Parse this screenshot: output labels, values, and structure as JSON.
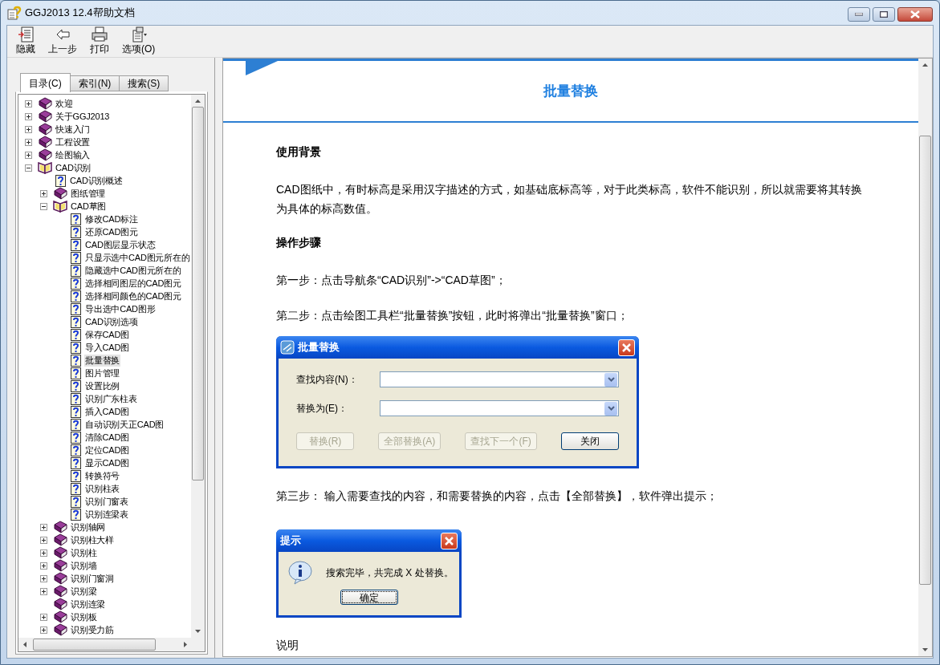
{
  "window": {
    "title": "GGJ2013 12.4帮助文档"
  },
  "toolbar": [
    {
      "label": "隐藏",
      "kind": "hide"
    },
    {
      "label": "上一步",
      "kind": "back"
    },
    {
      "label": "打印",
      "kind": "print"
    },
    {
      "label": "选项(O)",
      "kind": "options"
    }
  ],
  "tabs": [
    {
      "label": "目录(C)",
      "selected": true
    },
    {
      "label": "索引(N)",
      "selected": false
    },
    {
      "label": "搜索(S)",
      "selected": false
    }
  ],
  "tree": [
    {
      "label": "欢迎",
      "kind": "book",
      "expanded": false,
      "selected": false
    },
    {
      "label": "关于GGJ2013",
      "kind": "book",
      "expanded": false,
      "selected": false
    },
    {
      "label": "快速入门",
      "kind": "book",
      "expanded": false,
      "selected": false
    },
    {
      "label": "工程设置",
      "kind": "book",
      "expanded": false,
      "selected": false
    },
    {
      "label": "绘图输入",
      "kind": "book",
      "expanded": false,
      "selected": false
    },
    {
      "label": "CAD识别",
      "kind": "book",
      "expanded": true,
      "selected": false,
      "children": [
        {
          "label": "CAD识别概述",
          "kind": "page",
          "selected": false
        },
        {
          "label": "图纸管理",
          "kind": "book",
          "expanded": false,
          "selected": false
        },
        {
          "label": "CAD草图",
          "kind": "book",
          "expanded": true,
          "selected": false,
          "children": [
            {
              "label": "修改CAD标注",
              "kind": "page",
              "selected": false
            },
            {
              "label": "还原CAD图元",
              "kind": "page",
              "selected": false
            },
            {
              "label": "CAD图层显示状态",
              "kind": "page",
              "selected": false
            },
            {
              "label": "只显示选中CAD图元所在的",
              "kind": "page",
              "selected": false
            },
            {
              "label": "隐藏选中CAD图元所在的",
              "kind": "page",
              "selected": false
            },
            {
              "label": "选择相同图层的CAD图元",
              "kind": "page",
              "selected": false
            },
            {
              "label": "选择相同颜色的CAD图元",
              "kind": "page",
              "selected": false
            },
            {
              "label": "导出选中CAD图形",
              "kind": "page",
              "selected": false
            },
            {
              "label": "CAD识别选项",
              "kind": "page",
              "selected": false
            },
            {
              "label": "保存CAD图",
              "kind": "page",
              "selected": false
            },
            {
              "label": "导入CAD图",
              "kind": "page",
              "selected": false
            },
            {
              "label": "批量替换",
              "kind": "page",
              "selected": true
            },
            {
              "label": "图片管理",
              "kind": "page",
              "selected": false
            },
            {
              "label": "设置比例",
              "kind": "page",
              "selected": false
            },
            {
              "label": "识别广东柱表",
              "kind": "page",
              "selected": false
            },
            {
              "label": "插入CAD图",
              "kind": "page",
              "selected": false
            },
            {
              "label": "自动识别天正CAD图",
              "kind": "page",
              "selected": false
            },
            {
              "label": "清除CAD图",
              "kind": "page",
              "selected": false
            },
            {
              "label": "定位CAD图",
              "kind": "page",
              "selected": false
            },
            {
              "label": "显示CAD图",
              "kind": "page",
              "selected": false
            },
            {
              "label": "转换符号",
              "kind": "page",
              "selected": false
            },
            {
              "label": "识别柱表",
              "kind": "page",
              "selected": false
            },
            {
              "label": "识别门窗表",
              "kind": "page",
              "selected": false
            },
            {
              "label": "识别连梁表",
              "kind": "page",
              "selected": false
            }
          ]
        },
        {
          "label": "识别轴网",
          "kind": "book",
          "expanded": false,
          "selected": false
        },
        {
          "label": "识别柱大样",
          "kind": "book",
          "expanded": false,
          "selected": false
        },
        {
          "label": "识别柱",
          "kind": "book",
          "expanded": false,
          "selected": false
        },
        {
          "label": "识别墙",
          "kind": "book",
          "expanded": false,
          "selected": false
        },
        {
          "label": "识别门窗洞",
          "kind": "book",
          "expanded": false,
          "selected": false
        },
        {
          "label": "识别梁",
          "kind": "book",
          "expanded": false,
          "selected": false
        },
        {
          "label": "识别连梁",
          "kind": "book",
          "selected": false
        },
        {
          "label": "识别板",
          "kind": "book",
          "expanded": false,
          "selected": false
        },
        {
          "label": "识别受力筋",
          "kind": "book",
          "expanded": false,
          "selected": false
        }
      ]
    }
  ],
  "content": {
    "title": "批量替换",
    "blocks": [
      {
        "kind": "heading",
        "text": "使用背景"
      },
      {
        "kind": "paragraph",
        "text": "CAD图纸中，有时标高是采用汉字描述的方式，如基础底标高等，对于此类标高，软件不能识别，所以就需要将其转换为具体的标高数值。"
      },
      {
        "kind": "heading",
        "text": "操作步骤"
      },
      {
        "kind": "paragraph",
        "text": "第一步：点击导航条“CAD识别”->“CAD草图”；"
      },
      {
        "kind": "paragraph",
        "text": "第二步：点击绘图工具栏“批量替换”按钮，此时将弹出“批量替换”窗口；"
      },
      {
        "kind": "replace-dialog",
        "title": "批量替换",
        "fields": [
          {
            "label": "查找内容(N)："
          },
          {
            "label": "替换为(E)："
          }
        ],
        "buttons": [
          {
            "label": "替换(R)",
            "disabled": true
          },
          {
            "label": "全部替换(A)",
            "disabled": true
          },
          {
            "label": "查找下一个(F)",
            "disabled": true
          },
          {
            "label": "关闭",
            "disabled": false
          }
        ]
      },
      {
        "kind": "paragraph",
        "text": "第三步： 输入需要查找的内容，和需要替换的内容，点击【全部替换】，软件弹出提示；"
      },
      {
        "kind": "message-dialog",
        "title": "提示",
        "message": "搜索完毕，共完成 X 处替换。",
        "button": "确定"
      },
      {
        "kind": "paragraph",
        "text": "说明"
      }
    ]
  }
}
